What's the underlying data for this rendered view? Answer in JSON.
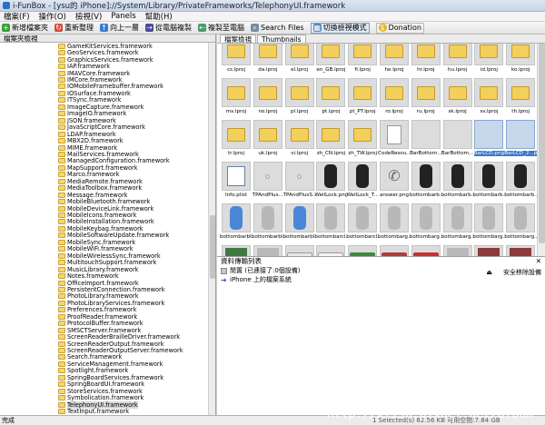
{
  "window": {
    "title": "i-FunBox - [ysu的 iPhone]://System/Library/PrivateFrameworks/TelephonyUI.framework"
  },
  "menu": [
    "檔案(F)",
    "操作(O)",
    "檢視(V)",
    "Panels",
    "幫助(H)"
  ],
  "toolbar": {
    "new_folder": "新增檔案夾",
    "refresh": "重新整理",
    "up": "向上一層",
    "copy_from_pc": "從電腦複製",
    "copy_to_pc": "複製至電腦",
    "search": "Search Files",
    "toggle_view": "切換檢視模式",
    "donation": "Donation"
  },
  "left_header": "檔案夾檢視",
  "tree_items": [
    "GameKitServices.framework",
    "GeoServices.framework",
    "GraphicsServices.framework",
    "IAP.framework",
    "IMAVCore.framework",
    "IMCore.framework",
    "IOMobileFramebuffer.framework",
    "IOSurface.framework",
    "ITSync.framework",
    "ImageCapture.framework",
    "ImageIO.framework",
    "JSON.framework",
    "JavaScriptCore.framework",
    "LDAP.framework",
    "MBX2D.framework",
    "MIME.framework",
    "MailServices.framework",
    "ManagedConfiguration.framework",
    "MapSupport.framework",
    "Marco.framework",
    "MediaRemote.framework",
    "MediaToolbox.framework",
    "Message.framework",
    "MobileBluetooth.framework",
    "MobileDeviceLink.framework",
    "MobileIcons.framework",
    "MobileInstallation.framework",
    "MobileKeybag.framework",
    "MobileSoftwareUpdate.framework",
    "MobileSync.framework",
    "MobileWiFi.framework",
    "MobileWirelessSync.framework",
    "MultitouchSupport.framework",
    "MusicLibrary.framework",
    "Notes.framework",
    "OfficeImport.framework",
    "PersistentConnection.framework",
    "PhotoLibrary.framework",
    "PhotoLibraryServices.framework",
    "Preferences.framework",
    "ProofReader.framework",
    "ProtocolBuffer.framework",
    "SMSCTServer.framework",
    "ScreenReaderBrailleDriver.framework",
    "ScreenReaderOutput.framework",
    "ScreenReaderOutputServer.framework",
    "Search.framework",
    "ServiceManagement.framework",
    "Spotlight.framework",
    "SpringBoardServices.framework",
    "SpringBoardUI.framework",
    "StoreServices.framework",
    "Symbolication.framework",
    "TelephonyUI.framework",
    "TextInput.framework"
  ],
  "tree_selected_index": 53,
  "tabs": [
    "檔案檢視",
    "Thumbnails"
  ],
  "grid_items": [
    {
      "label": "cs.lproj",
      "kind": "folder"
    },
    {
      "label": "da.lproj",
      "kind": "folder"
    },
    {
      "label": "el.lproj",
      "kind": "folder"
    },
    {
      "label": "en_GB.lproj",
      "kind": "folder"
    },
    {
      "label": "fi.lproj",
      "kind": "folder"
    },
    {
      "label": "he.lproj",
      "kind": "folder"
    },
    {
      "label": "hr.lproj",
      "kind": "folder"
    },
    {
      "label": "hu.lproj",
      "kind": "folder"
    },
    {
      "label": "id.lproj",
      "kind": "folder"
    },
    {
      "label": "ko.lproj",
      "kind": "folder"
    },
    {
      "label": "ms.lproj",
      "kind": "folder"
    },
    {
      "label": "no.lproj",
      "kind": "folder"
    },
    {
      "label": "pl.lproj",
      "kind": "folder"
    },
    {
      "label": "pt.lproj",
      "kind": "folder"
    },
    {
      "label": "pt_PT.lproj",
      "kind": "folder"
    },
    {
      "label": "ro.lproj",
      "kind": "folder"
    },
    {
      "label": "ru.lproj",
      "kind": "folder"
    },
    {
      "label": "sk.lproj",
      "kind": "folder"
    },
    {
      "label": "sv.lproj",
      "kind": "folder"
    },
    {
      "label": "th.lproj",
      "kind": "folder"
    },
    {
      "label": "tr.lproj",
      "kind": "folder"
    },
    {
      "label": "uk.lproj",
      "kind": "folder"
    },
    {
      "label": "vi.lproj",
      "kind": "folder"
    },
    {
      "label": "zh_CN.lproj",
      "kind": "folder"
    },
    {
      "label": "zh_TW.lproj",
      "kind": "folder"
    },
    {
      "label": "CodeResou...",
      "kind": "doc"
    },
    {
      "label": "BarBottom...",
      "kind": "blank"
    },
    {
      "label": "BarBottom...",
      "kind": "blank"
    },
    {
      "label": "BarLCD.png",
      "kind": "blank",
      "selected": true
    },
    {
      "label": "BarLCD_2...png",
      "kind": "blank",
      "selected": true
    },
    {
      "label": "Info.plist",
      "kind": "plist"
    },
    {
      "label": "TPAndPlus...",
      "kind": "dot"
    },
    {
      "label": "TPAndPlusS...",
      "kind": "dot"
    },
    {
      "label": "WellLock.png",
      "kind": "dark"
    },
    {
      "label": "WellLock_T...",
      "kind": "dark"
    },
    {
      "label": "answer.png",
      "kind": "phone"
    },
    {
      "label": "bottombarb...",
      "kind": "dark"
    },
    {
      "label": "bottombarb...",
      "kind": "dark"
    },
    {
      "label": "bottombarb...",
      "kind": "dark"
    },
    {
      "label": "bottombarb...",
      "kind": "dark"
    },
    {
      "label": "bottombarbl...",
      "kind": "blue"
    },
    {
      "label": "bottombarbl...",
      "kind": "bgray"
    },
    {
      "label": "bottombarbl...",
      "kind": "blue"
    },
    {
      "label": "bottombarcl...",
      "kind": "bgray"
    },
    {
      "label": "bottombarcl...",
      "kind": "bgray"
    },
    {
      "label": "bottombarg...",
      "kind": "bgray"
    },
    {
      "label": "bottombarg...",
      "kind": "bgray"
    },
    {
      "label": "bottombarg...",
      "kind": "bgray"
    },
    {
      "label": "bottombarg...",
      "kind": "bgray"
    },
    {
      "label": "bottombarg...",
      "kind": "bgray"
    },
    {
      "label": "",
      "kind": "green"
    },
    {
      "label": "",
      "kind": "lgray"
    },
    {
      "label": "",
      "kind": "arrow-white"
    },
    {
      "label": "",
      "kind": "arrow-black"
    },
    {
      "label": "",
      "kind": "arrow-green"
    },
    {
      "label": "",
      "kind": "arrow-red"
    },
    {
      "label": "",
      "kind": "arrow-redbox"
    },
    {
      "label": "",
      "kind": "lgray"
    },
    {
      "label": "",
      "kind": "red"
    },
    {
      "label": "",
      "kind": "red"
    }
  ],
  "transfer": {
    "header": "資料傳輸列表",
    "row1": "閒置 (已連接了:0個設備)",
    "row2": "iPhone 上的檔案系統",
    "safe_remove": "安全移除設備"
  },
  "status": {
    "left": "完成",
    "right": "1 Selected(s) 82.56 KB   可用空間:7.84 GB"
  },
  "watermark": "http://xfish.pixnet.net/album",
  "colors": {
    "selection": "#3a78c9",
    "folder": "#f3cf5c",
    "toolbar_toggle": "#dfe9f5"
  }
}
